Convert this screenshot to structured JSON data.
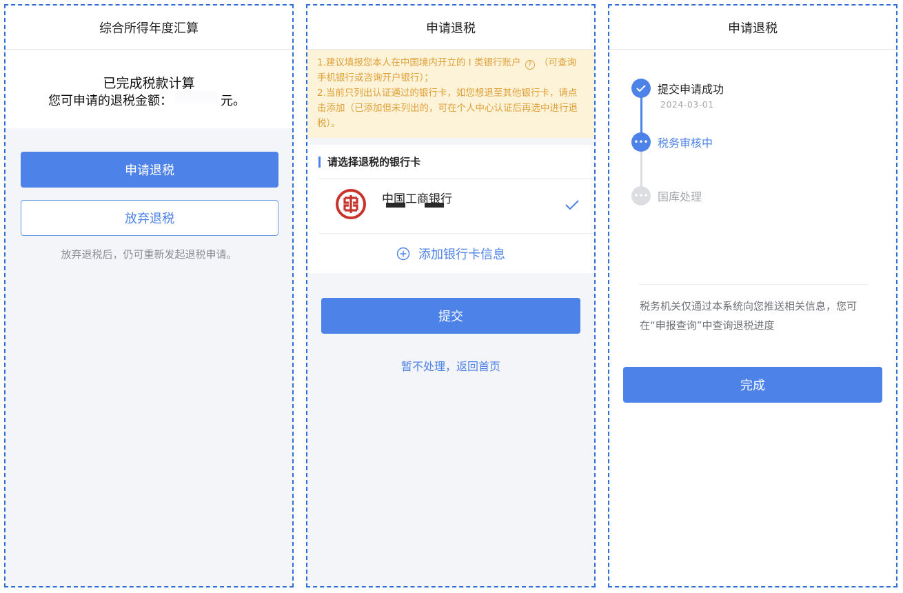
{
  "panel1": {
    "title": "综合所得年度汇算",
    "summary_line1": "已完成税款计算",
    "summary_line2_prefix": "您可申请的退税金额：",
    "summary_line2_suffix": "元。",
    "apply_button": "申请退税",
    "abandon_button": "放弃退税",
    "hint": "放弃退税后，仍可重新发起退税申请。"
  },
  "panel2": {
    "title": "申请退税",
    "notice_1a": "1.建议填报您本人在中国境内开立的 I 类银行账户",
    "notice_1b": "（可查询手机银行或咨询开户银行）；",
    "notice_2": "2.当前只列出认证通过的银行卡，如您想退至其他银行卡，请点击添加（已添加但未列出的，可在个人中心认证后再选中进行退税）。",
    "section_title": "请选择退税的银行卡",
    "bank_name": "中国工商银行",
    "add_card": "添加银行卡信息",
    "submit_button": "提交",
    "skip_link": "暂不处理，返回首页",
    "colors": {
      "accent": "#4d82e8",
      "notice_text": "#e0a03a",
      "notice_bg": "#fdf3d8",
      "bank_red": "#c8332c"
    }
  },
  "panel3": {
    "title": "申请退税",
    "steps": [
      {
        "label": "提交申请成功",
        "date": "2024-03-01",
        "state": "done"
      },
      {
        "label": "税务审核中",
        "state": "active"
      },
      {
        "label": "国库处理",
        "state": "pending"
      }
    ],
    "note": "税务机关仅通过本系统向您推送相关信息，您可在“申报查询”中查询退税进度",
    "done_button": "完成"
  }
}
